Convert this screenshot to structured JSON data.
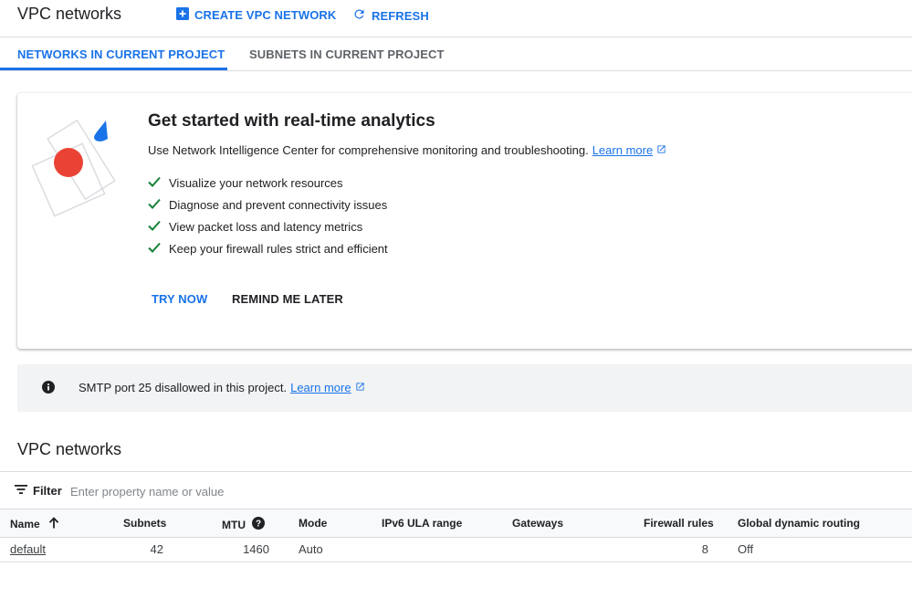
{
  "header": {
    "title": "VPC networks",
    "create_label": "CREATE VPC NETWORK",
    "refresh_label": "REFRESH"
  },
  "tabs": [
    {
      "label": "NETWORKS IN CURRENT PROJECT",
      "active": true
    },
    {
      "label": "SUBNETS IN CURRENT PROJECT",
      "active": false
    }
  ],
  "promo": {
    "title": "Get started with real-time analytics",
    "description": "Use Network Intelligence Center for comprehensive monitoring and troubleshooting.",
    "learn_more": "Learn more",
    "features": [
      "Visualize your network resources",
      "Diagnose and prevent connectivity issues",
      "View packet loss and latency metrics",
      "Keep your firewall rules strict and efficient"
    ],
    "try_now": "TRY NOW",
    "remind_later": "REMIND ME LATER"
  },
  "banner": {
    "text": "SMTP port 25 disallowed in this project.",
    "learn_more": "Learn more"
  },
  "networks": {
    "title": "VPC networks",
    "filter_label": "Filter",
    "filter_placeholder": "Enter property name or value",
    "columns": {
      "name": "Name",
      "subnets": "Subnets",
      "mtu": "MTU",
      "mode": "Mode",
      "ipv6": "IPv6 ULA range",
      "gateways": "Gateways",
      "firewall": "Firewall rules",
      "routing": "Global dynamic routing"
    },
    "rows": [
      {
        "name": "default",
        "subnets": "42",
        "mtu": "1460",
        "mode": "Auto",
        "ipv6": "",
        "gateways": "",
        "firewall": "8",
        "routing": "Off"
      }
    ]
  },
  "colors": {
    "accent": "#1a73e8",
    "check": "#188038",
    "red_dot": "#ea4335"
  }
}
